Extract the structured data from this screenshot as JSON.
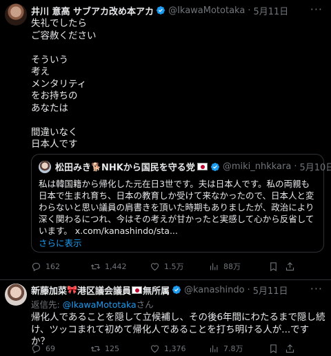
{
  "tweet1": {
    "display_name": "井川 意高 サブアカ改め本アカ",
    "handle": "@IkawaMototaka",
    "separator": "·",
    "date": "5月11日",
    "more": "···",
    "text": "失礼でしたら\nご容赦ください\n\nそういう\n考え\nメンタリティ\nをお持ちの\nあなたは\n\n間違いなく\n日本人です",
    "quote": {
      "display_name_pre": "松田みき",
      "display_name_post": "NHKから国民を守る党",
      "handle": "@miki_nhkkara",
      "separator": "·",
      "date": "5月10日",
      "text": "私は韓国籍から帰化した元在日3世です。夫は日本人です。私の両親も日本で生まれ育ち、日本の教育しか受けて来なかったので、日本人と変わらないと思い議員の肩書きを頂いた時期もありましたが、政治により深く関わるにつれ、今はその考えが甘かったと実感して心から反省しています。 x.com/kanashindo/sta...",
      "show_more": "さらに表示"
    },
    "actions": {
      "replies": "162",
      "reposts": "1,442",
      "likes": "1.5万",
      "views": "88万"
    }
  },
  "tweet2": {
    "display_name_a": "新藤加菜",
    "display_name_b": "港区議会議員",
    "display_name_c": "無所属",
    "handle": "@kanashindo",
    "separator": "·",
    "date": "5月11日",
    "more": "···",
    "reply_prefix": "返信先: ",
    "reply_handle": "@IkawaMototaka",
    "reply_suffix": "さん",
    "text": "帰化人であることを隠して立候補し、その後6年間にわたるまで隠し続け、ツッコまれて初めて帰化人であることを打ち明ける人が...ですか？",
    "actions": {
      "replies": "69",
      "reposts": "125",
      "likes": "1,376",
      "views": "7.8万"
    }
  },
  "colors": {
    "accent": "#1d9bf0",
    "muted": "#71767b",
    "text": "#e7e9ea",
    "bg": "#000000"
  },
  "icons": [
    "verified-badge-icon",
    "reply-icon",
    "repost-icon",
    "like-icon",
    "views-icon",
    "bookmark-icon",
    "share-icon",
    "more-icon",
    "japan-flag-icon"
  ]
}
